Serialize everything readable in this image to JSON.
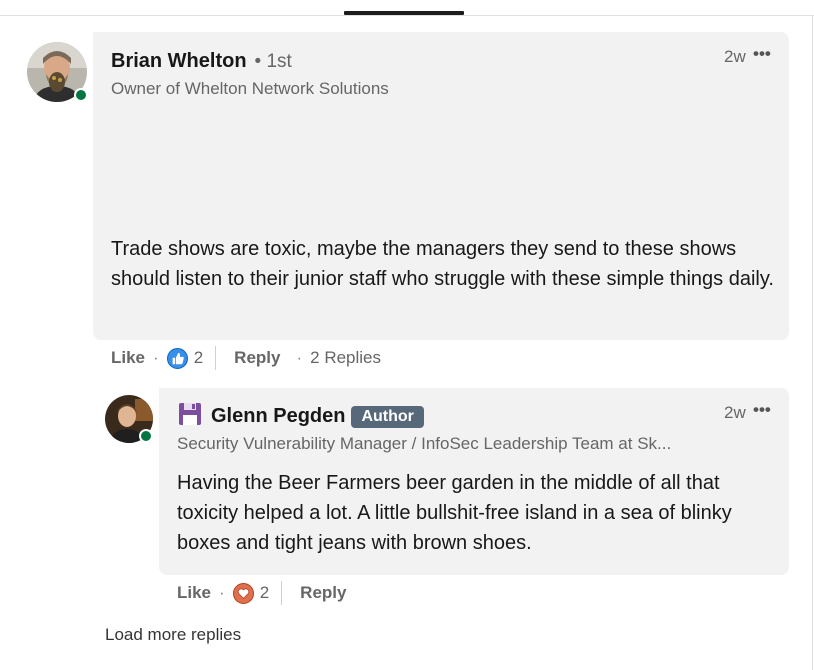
{
  "comment": {
    "author_name": "Brian Whelton",
    "degree": "• 1st",
    "headline": "Owner of Whelton Network Solutions",
    "timestamp": "2w",
    "text": "Trade shows are toxic, maybe the managers they send to these shows should listen to their junior staff who struggle with these simple things daily.",
    "actions": {
      "like_label": "Like",
      "reaction_count": "2",
      "reply_label": "Reply",
      "replies_label": "2 Replies"
    },
    "reaction_icon": "like-reaction-icon"
  },
  "reply": {
    "author_name": "Glenn Pegden",
    "author_badge": "Author",
    "headline": "Security Vulnerability Manager / InfoSec Leadership Team at Sk...",
    "timestamp": "2w",
    "text": "Having the Beer Farmers beer garden in the middle of all that toxicity helped a lot. A little bullshit-free island in a sea of blinky boxes and tight jeans with brown shoes.",
    "actions": {
      "like_label": "Like",
      "reaction_count": "2",
      "reply_label": "Reply"
    },
    "reaction_icon": "love-reaction-icon",
    "name_icon": "floppy-disk-icon"
  },
  "load_more": "Load more replies",
  "colors": {
    "bubble": "#f2f2f2",
    "presence": "#057642",
    "like": "#378fe9",
    "love": "#df704d",
    "author_badge": "#56687a"
  }
}
